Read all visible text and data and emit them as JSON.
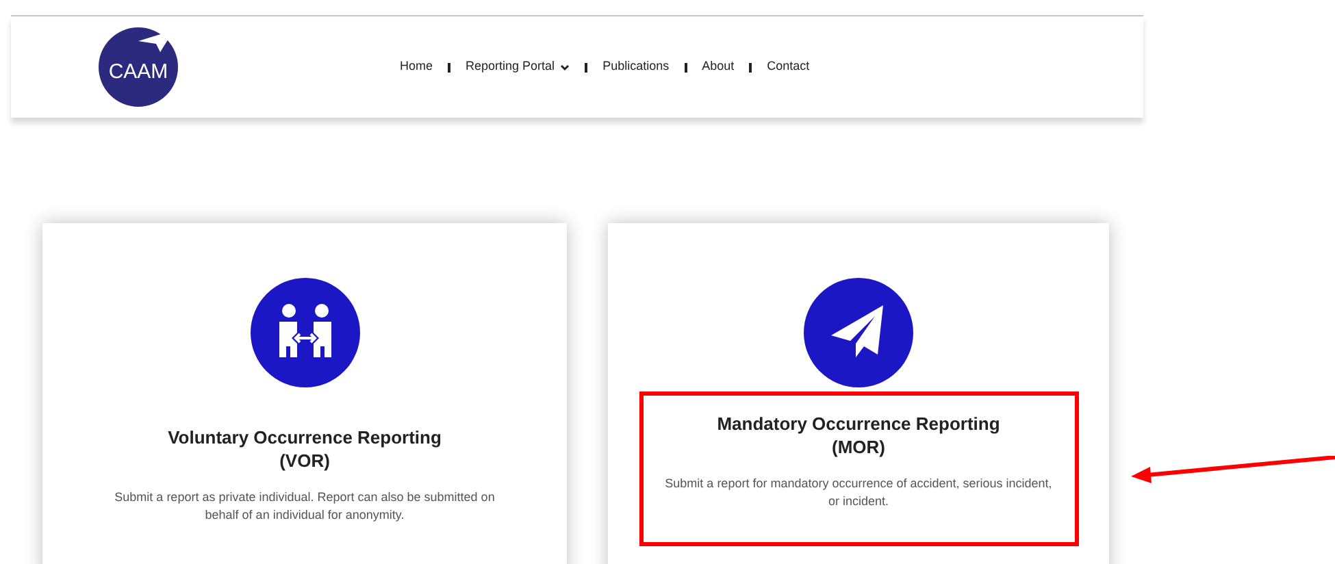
{
  "header": {
    "logo_text": "CAAM",
    "nav": [
      {
        "label": "Home",
        "has_dropdown": false
      },
      {
        "label": "Reporting Portal",
        "has_dropdown": true
      },
      {
        "label": "Publications",
        "has_dropdown": false
      },
      {
        "label": "About",
        "has_dropdown": false
      },
      {
        "label": "Contact",
        "has_dropdown": false
      }
    ]
  },
  "cards": [
    {
      "kind": "people",
      "title": "Voluntary Occurrence Reporting",
      "abbreviation": "(VOR)",
      "description": "Submit a report as private individual. Report can also be submitted on behalf of an individual for anonymity.",
      "highlighted": false
    },
    {
      "kind": "plane",
      "title": "Mandatory Occurrence Reporting",
      "abbreviation": "(MOR)",
      "description": "Submit a report for mandatory occurrence of accident, serious incident, or incident.",
      "highlighted": true
    }
  ]
}
